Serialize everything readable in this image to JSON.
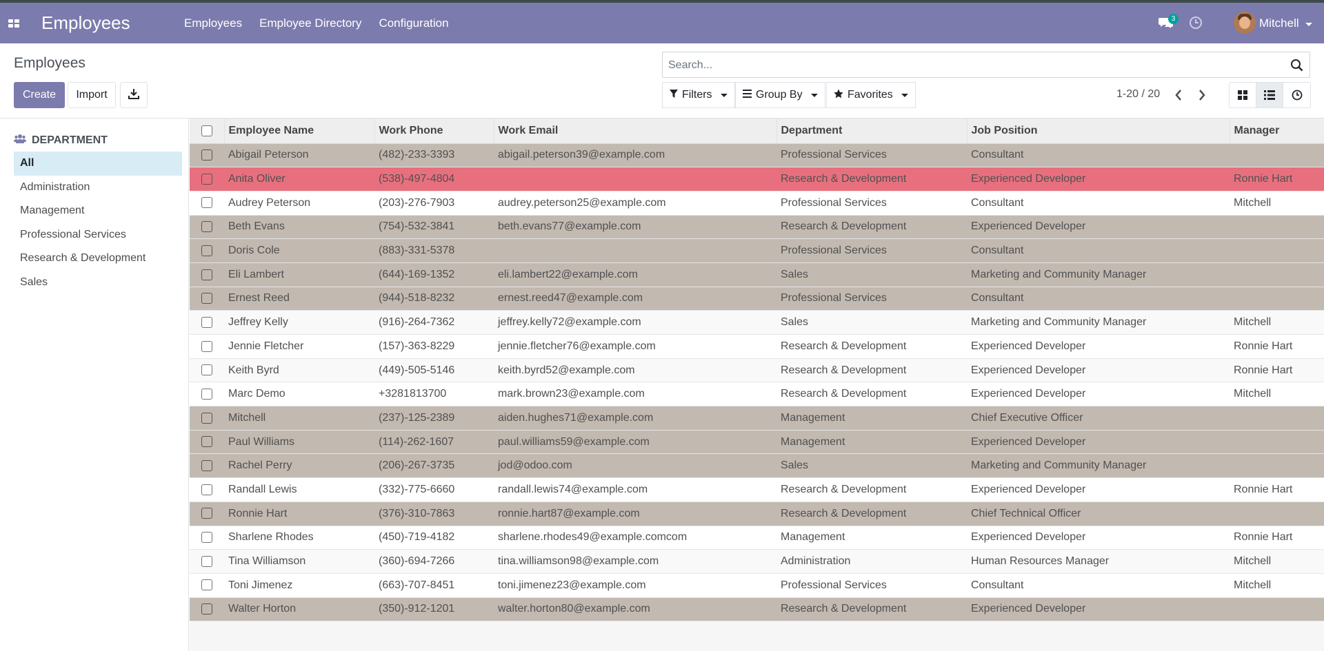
{
  "navbar": {
    "app_title": "Employees",
    "menu": [
      "Employees",
      "Employee Directory",
      "Configuration"
    ],
    "chat_count": "3",
    "user_name": "Mitchell",
    "color": "#7c7bad"
  },
  "control_panel": {
    "title": "Employees",
    "create_label": "Create",
    "import_label": "Import",
    "search_placeholder": "Search...",
    "filters_label": "Filters",
    "groupby_label": "Group By",
    "favorites_label": "Favorites",
    "pager": "1-20 / 20"
  },
  "sidepanel": {
    "header": "DEPARTMENT",
    "items": [
      "All",
      "Administration",
      "Management",
      "Professional Services",
      "Research & Development",
      "Sales"
    ],
    "active": "All"
  },
  "table": {
    "columns": [
      "Employee Name",
      "Work Phone",
      "Work Email",
      "Department",
      "Job Position",
      "Manager"
    ],
    "rows": [
      {
        "state": "archived",
        "cells": [
          "Abigail Peterson",
          "(482)-233-3393",
          "abigail.peterson39@example.com",
          "Professional Services",
          "Consultant",
          ""
        ]
      },
      {
        "state": "alert",
        "cells": [
          "Anita Oliver",
          "(538)-497-4804",
          "",
          "Research & Development",
          "Experienced Developer",
          "Ronnie Hart"
        ]
      },
      {
        "state": "normal",
        "cells": [
          "Audrey Peterson",
          "(203)-276-7903",
          "audrey.peterson25@example.com",
          "Professional Services",
          "Consultant",
          "Mitchell"
        ]
      },
      {
        "state": "archived",
        "cells": [
          "Beth Evans",
          "(754)-532-3841",
          "beth.evans77@example.com",
          "Research & Development",
          "Experienced Developer",
          ""
        ]
      },
      {
        "state": "archived",
        "cells": [
          "Doris Cole",
          "(883)-331-5378",
          "",
          "Professional Services",
          "Consultant",
          ""
        ]
      },
      {
        "state": "archived",
        "cells": [
          "Eli Lambert",
          "(644)-169-1352",
          "eli.lambert22@example.com",
          "Sales",
          "Marketing and Community Manager",
          ""
        ]
      },
      {
        "state": "archived",
        "cells": [
          "Ernest Reed",
          "(944)-518-8232",
          "ernest.reed47@example.com",
          "Professional Services",
          "Consultant",
          ""
        ]
      },
      {
        "state": "normal",
        "cells": [
          "Jeffrey Kelly",
          "(916)-264-7362",
          "jeffrey.kelly72@example.com",
          "Sales",
          "Marketing and Community Manager",
          "Mitchell"
        ]
      },
      {
        "state": "normal",
        "cells": [
          "Jennie Fletcher",
          "(157)-363-8229",
          "jennie.fletcher76@example.com",
          "Research & Development",
          "Experienced Developer",
          "Ronnie Hart"
        ]
      },
      {
        "state": "normal",
        "cells": [
          "Keith Byrd",
          "(449)-505-5146",
          "keith.byrd52@example.com",
          "Research & Development",
          "Experienced Developer",
          "Ronnie Hart"
        ]
      },
      {
        "state": "normal",
        "cells": [
          "Marc Demo",
          "+3281813700",
          "mark.brown23@example.com",
          "Research & Development",
          "Experienced Developer",
          "Mitchell"
        ]
      },
      {
        "state": "archived",
        "cells": [
          "Mitchell",
          "(237)-125-2389",
          "aiden.hughes71@example.com",
          "Management",
          "Chief Executive Officer",
          ""
        ]
      },
      {
        "state": "archived",
        "cells": [
          "Paul Williams",
          "(114)-262-1607",
          "paul.williams59@example.com",
          "Management",
          "Experienced Developer",
          ""
        ]
      },
      {
        "state": "archived",
        "cells": [
          "Rachel Perry",
          "(206)-267-3735",
          "jod@odoo.com",
          "Sales",
          "Marketing and Community Manager",
          ""
        ]
      },
      {
        "state": "normal",
        "cells": [
          "Randall Lewis",
          "(332)-775-6660",
          "randall.lewis74@example.com",
          "Research & Development",
          "Experienced Developer",
          "Ronnie Hart"
        ]
      },
      {
        "state": "archived",
        "cells": [
          "Ronnie Hart",
          "(376)-310-7863",
          "ronnie.hart87@example.com",
          "Research & Development",
          "Chief Technical Officer",
          ""
        ]
      },
      {
        "state": "normal",
        "cells": [
          "Sharlene Rhodes",
          "(450)-719-4182",
          "sharlene.rhodes49@example.comcom",
          "Management",
          "Experienced Developer",
          "Ronnie Hart"
        ]
      },
      {
        "state": "normal",
        "cells": [
          "Tina Williamson",
          "(360)-694-7266",
          "tina.williamson98@example.com",
          "Administration",
          "Human Resources Manager",
          "Mitchell"
        ]
      },
      {
        "state": "normal",
        "cells": [
          "Toni Jimenez",
          "(663)-707-8451",
          "toni.jimenez23@example.com",
          "Professional Services",
          "Consultant",
          "Mitchell"
        ]
      },
      {
        "state": "archived",
        "cells": [
          "Walter Horton",
          "(350)-912-1201",
          "walter.horton80@example.com",
          "Research & Development",
          "Experienced Developer",
          ""
        ]
      }
    ]
  },
  "colors": {
    "primary": "#7c7bad",
    "archived_row": "#c2b9b1",
    "alert_row": "#e8707e",
    "active_filter": "#d8ecf6",
    "badge": "#00a09d"
  },
  "icons": [
    "apps-icon",
    "chat-icon",
    "clock-icon",
    "download-icon",
    "search-icon",
    "filter-icon",
    "groupby-icon",
    "star-icon",
    "chevron-left-icon",
    "chevron-right-icon",
    "kanban-view-icon",
    "list-view-icon",
    "activity-view-icon",
    "users-icon"
  ]
}
